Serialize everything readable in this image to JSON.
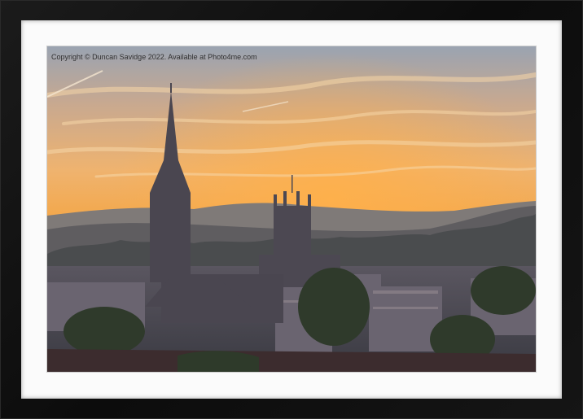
{
  "photo": {
    "watermark": "Copyright © Duncan Savidge 2022. Available at Photo4me.com",
    "subject": "sunset-city-skyline"
  },
  "colors": {
    "frame": "#111111",
    "mount": "#fbfbfb",
    "sky_top": "#9aa3b1",
    "sky_mid": "#f0b46a",
    "sky_low": "#f6a43a",
    "silhouette": "#3b3c44"
  }
}
